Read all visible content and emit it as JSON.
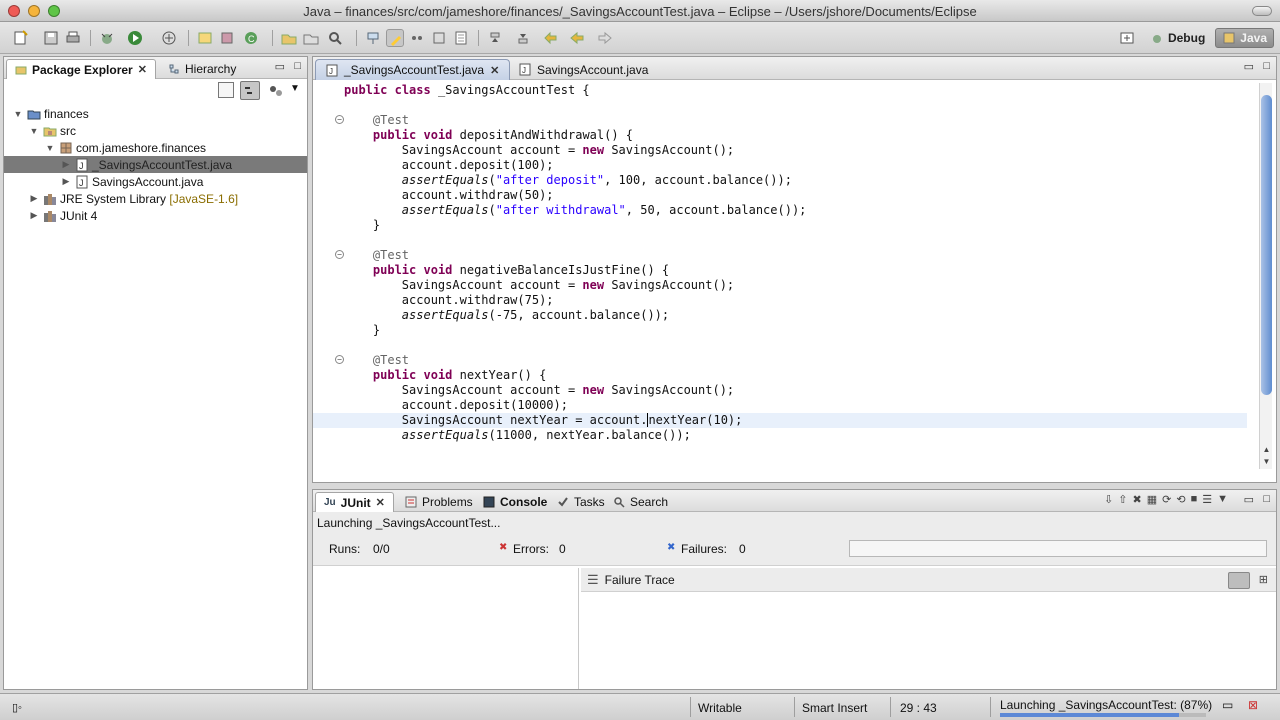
{
  "window": {
    "title": "Java – finances/src/com/jameshore/finances/_SavingsAccountTest.java – Eclipse – /Users/jshore/Documents/Eclipse",
    "traffic_colors": [
      "#ef5b56",
      "#f5b43c",
      "#5fc547"
    ]
  },
  "perspectives": {
    "debug_label": "Debug",
    "java_label": "Java"
  },
  "package_explorer": {
    "tabs": [
      {
        "label": "Package Explorer",
        "active": true
      },
      {
        "label": "Hierarchy",
        "active": false
      }
    ],
    "tree": [
      {
        "label": "finances",
        "icon": "project-icon"
      },
      {
        "label": "src",
        "icon": "source-folder-icon"
      },
      {
        "label": "com.jameshore.finances",
        "icon": "package-icon"
      },
      {
        "label": "_SavingsAccountTest.java",
        "icon": "java-file-icon",
        "selected": true
      },
      {
        "label": "SavingsAccount.java",
        "icon": "java-file-icon"
      },
      {
        "label": "JRE System Library",
        "decoration": "[JavaSE-1.6]",
        "icon": "library-icon"
      },
      {
        "label": "JUnit 4",
        "icon": "library-icon"
      }
    ]
  },
  "editor": {
    "tabs": [
      {
        "label": "_SavingsAccountTest.java",
        "active": true
      },
      {
        "label": "SavingsAccount.java",
        "active": false
      }
    ],
    "current_line_index": 22
  },
  "bottom_panel": {
    "tabs": [
      {
        "label": "JUnit",
        "active": true
      },
      {
        "label": "Problems"
      },
      {
        "label": "Console"
      },
      {
        "label": "Tasks"
      },
      {
        "label": "Search"
      }
    ],
    "status": "Launching _SavingsAccountTest...",
    "runs_label": "Runs:",
    "runs_value": "0/0",
    "errors_label": "Errors:",
    "errors_value": "0",
    "failures_label": "Failures:",
    "failures_value": "0",
    "progress_fraction": 0.0,
    "failure_trace_label": "Failure Trace"
  },
  "status_bar": {
    "writable": "Writable",
    "insert_mode": "Smart Insert",
    "cursor_position": "29 : 43",
    "progress_text": "Launching _SavingsAccountTest: (87%)",
    "progress_fraction": 0.87
  }
}
